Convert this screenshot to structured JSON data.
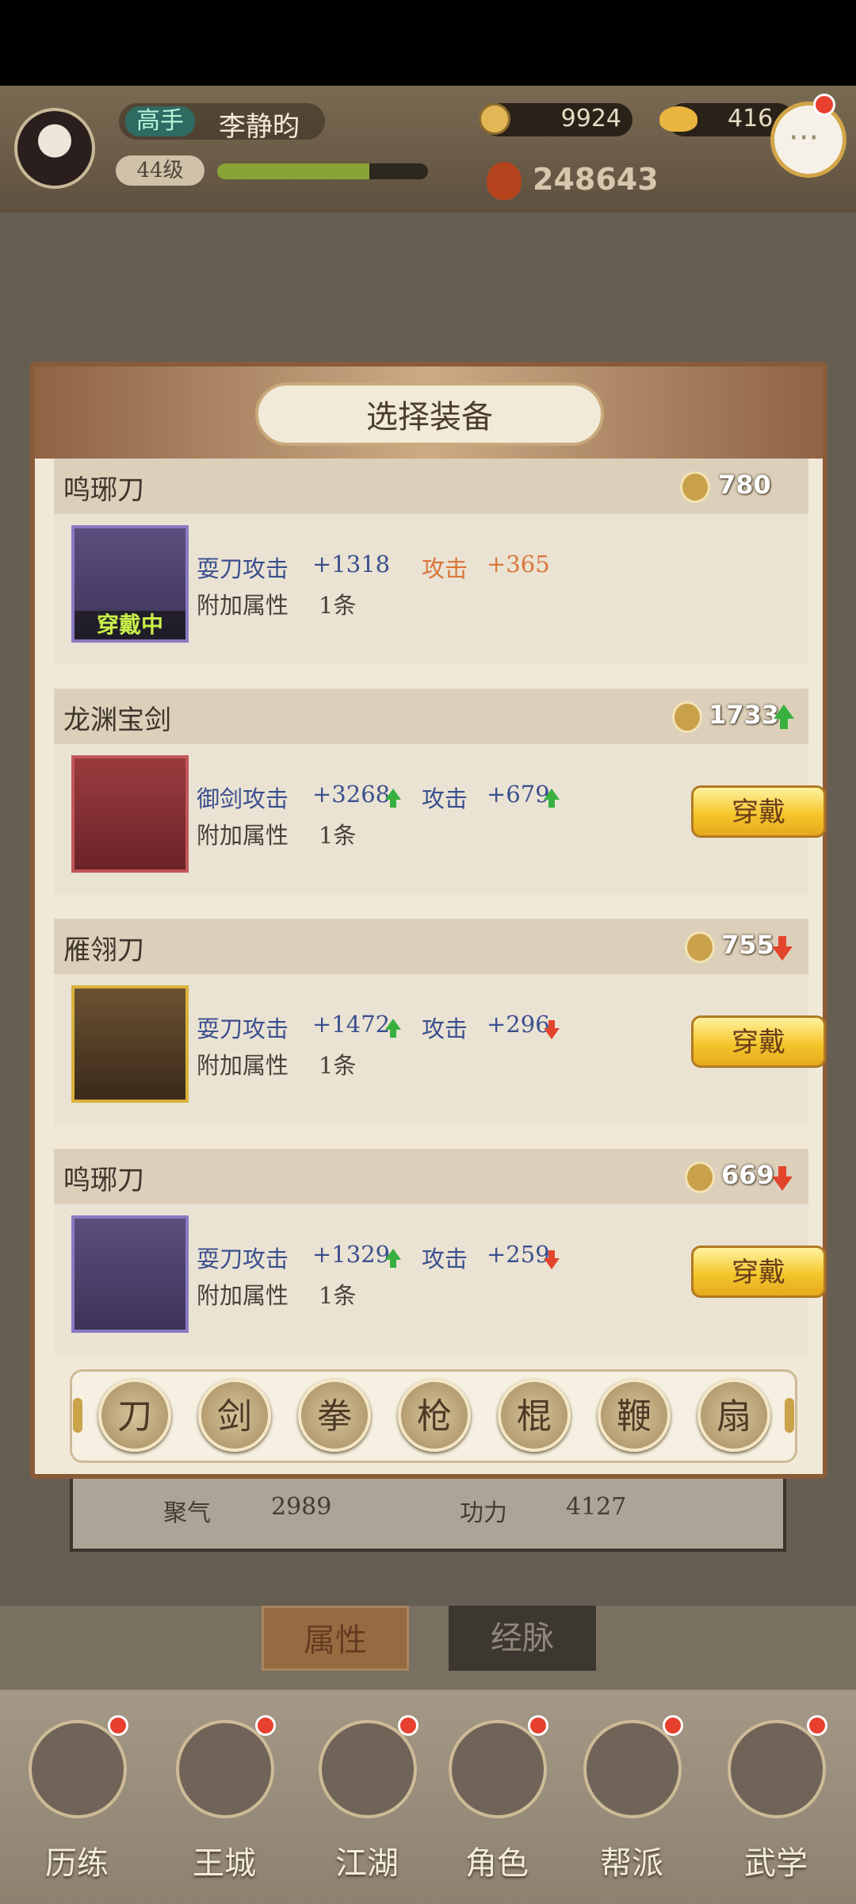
{
  "player": {
    "rank": "高手",
    "name": "李静昀",
    "level": "44级",
    "exp_progress": 0.72,
    "coins": "9924",
    "ingots": "416",
    "power": "248643"
  },
  "modal": {
    "title": "选择装备",
    "equipped_label": "穿戴中",
    "equip_label": "穿戴",
    "extra_attr_label": "附加属性",
    "extra_attr_count": "1条",
    "items": [
      {
        "name": "鸣琊刀",
        "score": "780",
        "score_trend": "none",
        "attr1_name": "耍刀攻击",
        "attr1_value": "+1318",
        "attr1_trend": "none",
        "attr2_name": "攻击",
        "attr2_value": "+365",
        "attr2_trend": "none",
        "equipped": true
      },
      {
        "name": "龙渊宝剑",
        "score": "1733",
        "score_trend": "up",
        "attr1_name": "御剑攻击",
        "attr1_value": "+3268",
        "attr1_trend": "up",
        "attr2_name": "攻击",
        "attr2_value": "+679",
        "attr2_trend": "up",
        "equipped": false
      },
      {
        "name": "雁翎刀",
        "score": "755",
        "score_trend": "down",
        "attr1_name": "耍刀攻击",
        "attr1_value": "+1472",
        "attr1_trend": "up",
        "attr2_name": "攻击",
        "attr2_value": "+296",
        "attr2_trend": "down",
        "equipped": false
      },
      {
        "name": "鸣琊刀",
        "score": "669",
        "score_trend": "down",
        "attr1_name": "耍刀攻击",
        "attr1_value": "+1329",
        "attr1_trend": "up",
        "attr2_name": "攻击",
        "attr2_value": "+259",
        "attr2_trend": "down",
        "equipped": false
      }
    ],
    "categories": [
      "刀",
      "剑",
      "拳",
      "枪",
      "棍",
      "鞭",
      "扇"
    ]
  },
  "stats": {
    "juqi_label": "聚气",
    "juqi_value": "2989",
    "gongli_label": "功力",
    "gongli_value": "4127"
  },
  "tabs": [
    "属性",
    "经脉"
  ],
  "nav": [
    "历练",
    "王城",
    "江湖",
    "角色",
    "帮派",
    "武学"
  ]
}
